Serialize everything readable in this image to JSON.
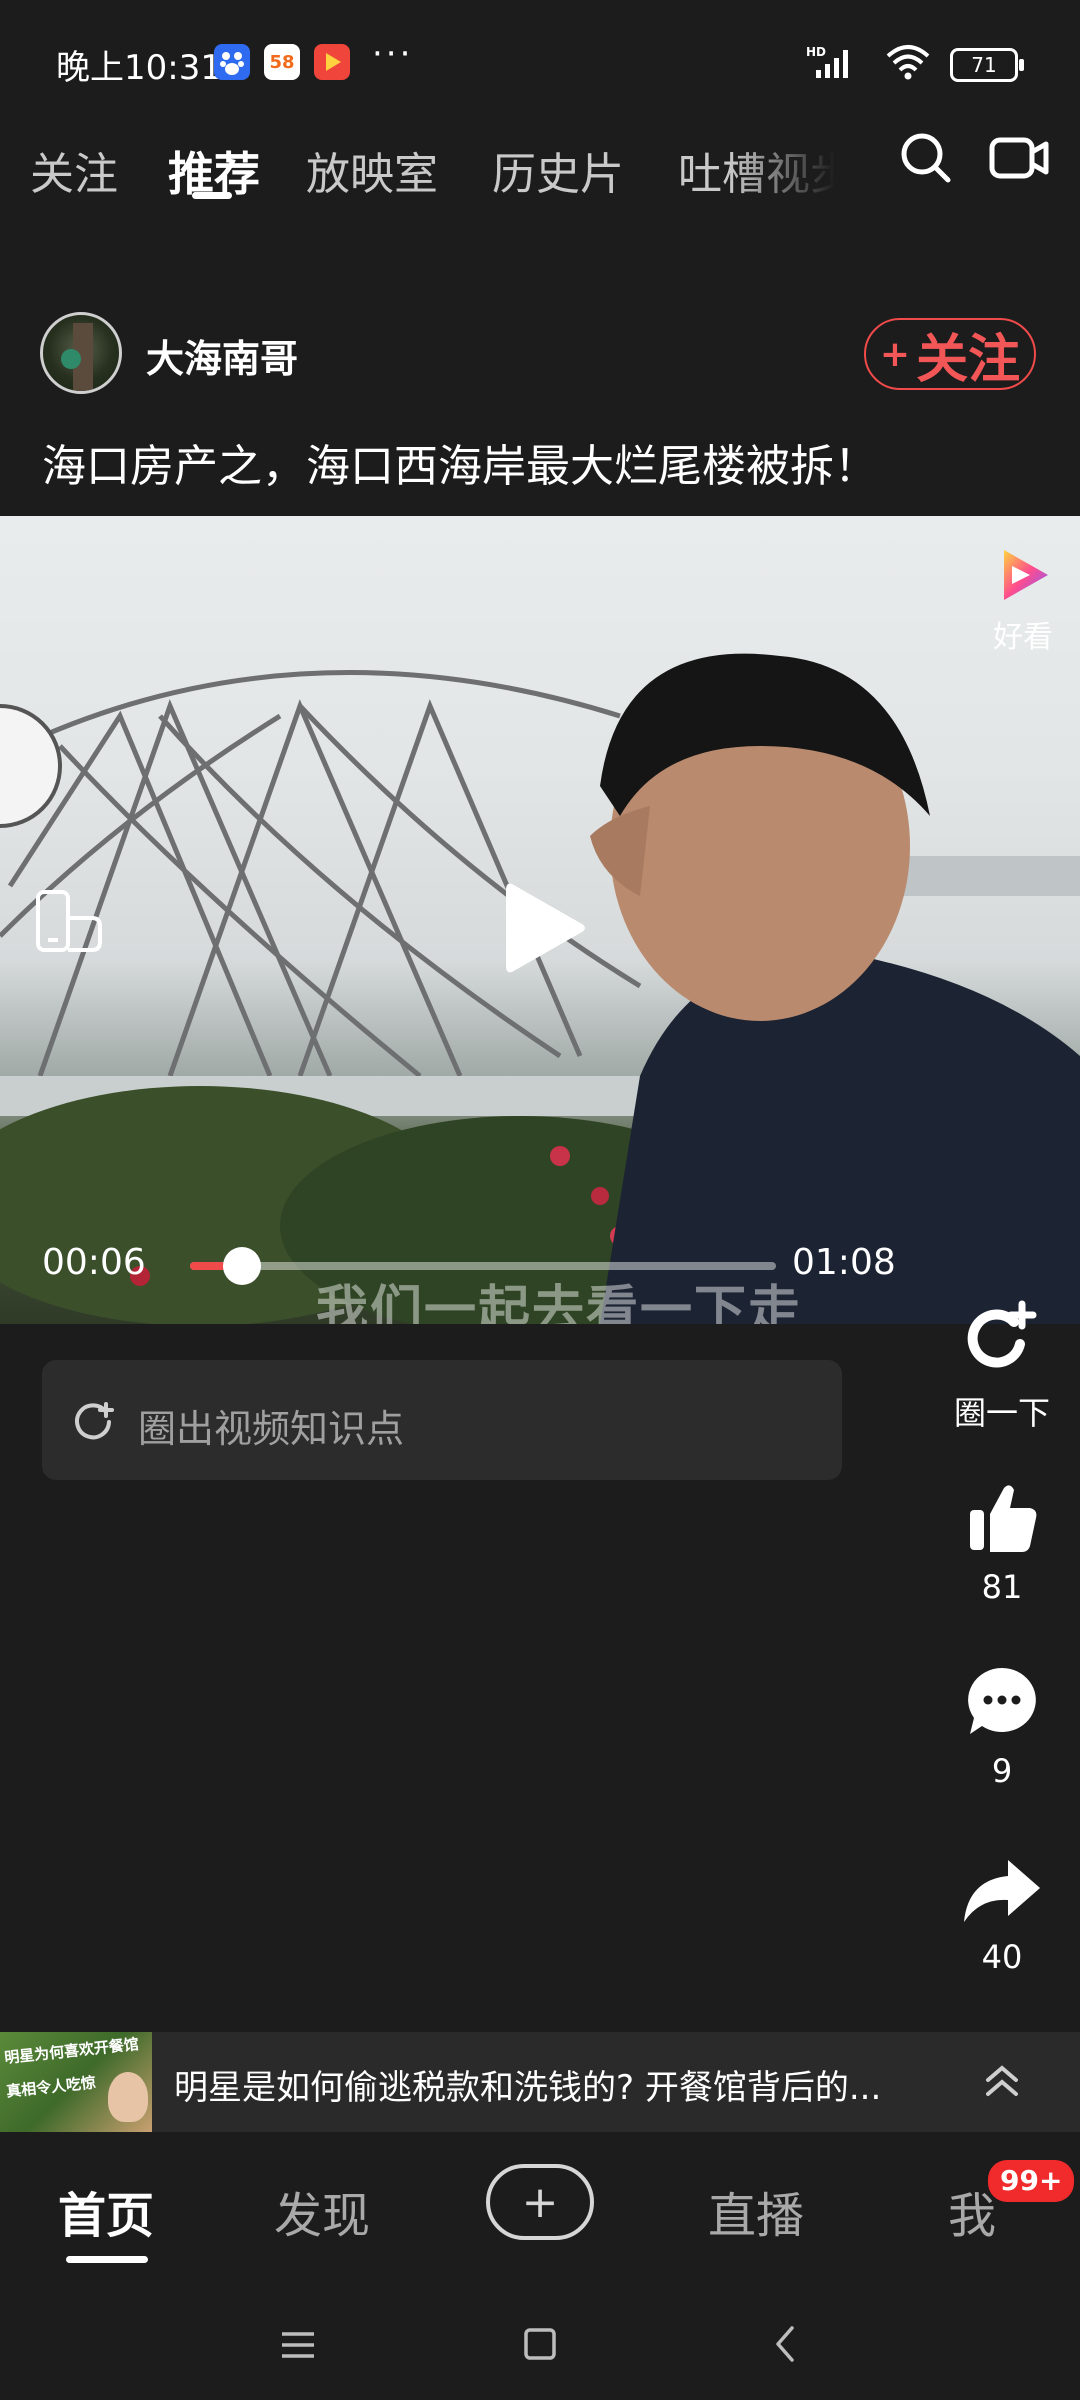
{
  "status_bar": {
    "time": "晚上10:31",
    "battery": "71",
    "network_label": "HD",
    "more": "···",
    "app_58_text": "58"
  },
  "tabs": [
    {
      "label": "关注"
    },
    {
      "label": "推荐"
    },
    {
      "label": "放映室"
    },
    {
      "label": "历史片"
    },
    {
      "label": "吐槽视步"
    }
  ],
  "post": {
    "author": "大海南哥",
    "follow_label": "关注",
    "follow_prefix": "+",
    "title": "海口房产之，海口西海岸最大烂尾楼被拆！"
  },
  "video": {
    "brand": "好看",
    "current_time": "00:06",
    "total_time": "01:08",
    "progress": 0.088,
    "subtitle": "我们一起去看一下走"
  },
  "knowledge": {
    "placeholder": "圈出视频知识点"
  },
  "actions": {
    "circle_label": "圈一下",
    "likes": "81",
    "comments": "9",
    "shares": "40"
  },
  "banner": {
    "text": "明星是如何偷逃税款和洗钱的? 开餐馆背后的...",
    "thumb_text_1": "明星为何喜欢开餐馆",
    "thumb_text_2": "真相令人吃惊"
  },
  "bottom_nav": [
    {
      "label": "首页"
    },
    {
      "label": "发现"
    },
    {
      "label": "+"
    },
    {
      "label": "直播"
    },
    {
      "label": "我"
    }
  ],
  "badge": "99+",
  "colors": {
    "background": "#1c1c1c",
    "accent_red": "#f04a4a",
    "badge_red": "#f12b2b"
  }
}
